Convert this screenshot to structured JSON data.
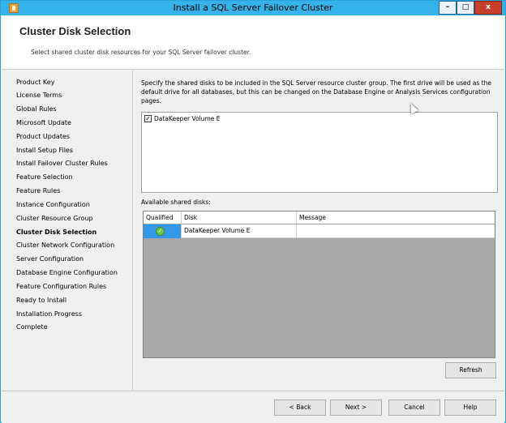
{
  "window": {
    "title": "Install a SQL Server Failover Cluster",
    "minimize": "–",
    "maximize": "□",
    "close": "x"
  },
  "header": {
    "title": "Cluster Disk Selection",
    "subtitle": "Select shared cluster disk resources for your SQL Server failover cluster."
  },
  "sidebar": {
    "items": [
      {
        "label": "Product Key"
      },
      {
        "label": "License Terms"
      },
      {
        "label": "Global Rules"
      },
      {
        "label": "Microsoft Update"
      },
      {
        "label": "Product Updates"
      },
      {
        "label": "Install Setup Files"
      },
      {
        "label": "Install Failover Cluster Rules"
      },
      {
        "label": "Feature Selection"
      },
      {
        "label": "Feature Rules"
      },
      {
        "label": "Instance Configuration"
      },
      {
        "label": "Cluster Resource Group"
      },
      {
        "label": "Cluster Disk Selection"
      },
      {
        "label": "Cluster Network Configuration"
      },
      {
        "label": "Server Configuration"
      },
      {
        "label": "Database Engine Configuration"
      },
      {
        "label": "Feature Configuration Rules"
      },
      {
        "label": "Ready to Install"
      },
      {
        "label": "Installation Progress"
      },
      {
        "label": "Complete"
      }
    ],
    "active": "Cluster Disk Selection"
  },
  "main": {
    "description": "Specify the shared disks to be included in the SQL Server resource cluster group. The first drive will be used as the default drive for all databases, but this can be changed on the Database Engine or Analysis Services configuration pages.",
    "disk_checklist": [
      {
        "label": "DataKeeper Volume E",
        "checked": true
      }
    ],
    "available_label": "Available shared disks:",
    "grid": {
      "columns": [
        "Qualified",
        "Disk",
        "Message"
      ],
      "rows": [
        {
          "qualified": "check-ok-icon",
          "disk": "DataKeeper Volume E",
          "message": ""
        }
      ]
    },
    "refresh_label": "Refresh"
  },
  "footer": {
    "back": "< Back",
    "next": "Next >",
    "cancel": "Cancel",
    "help": "Help"
  }
}
